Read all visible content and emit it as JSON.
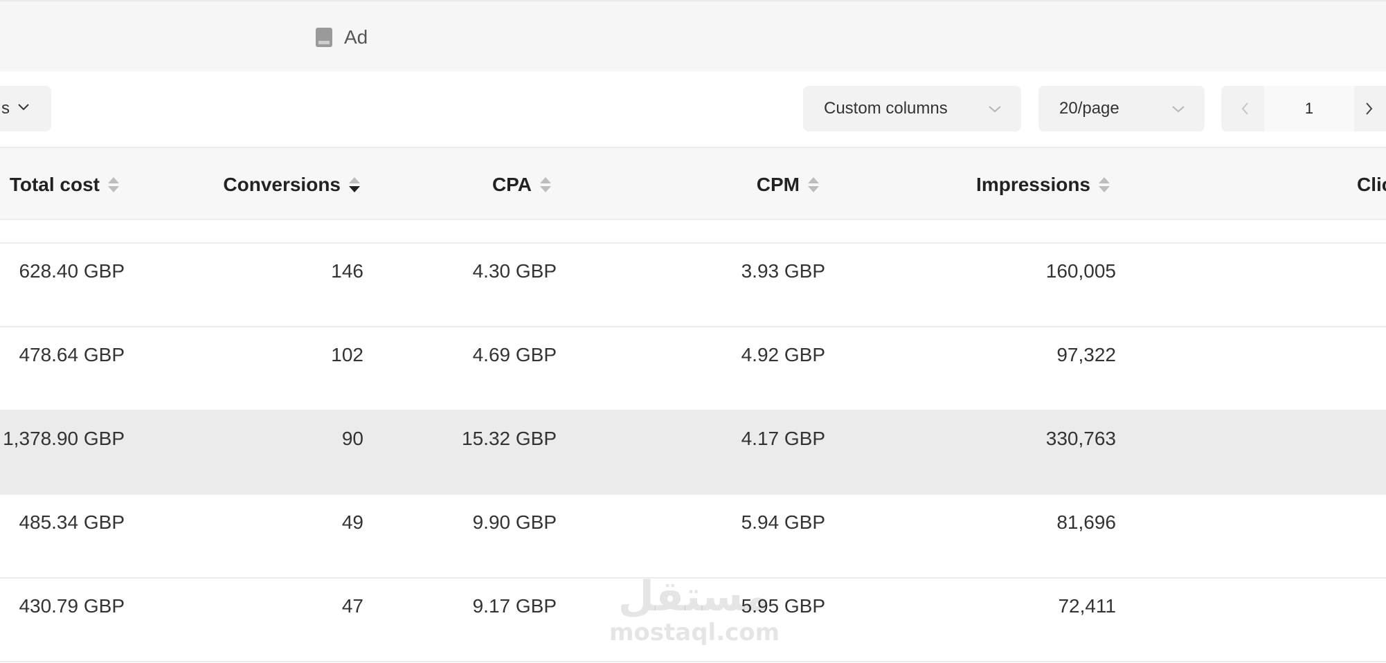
{
  "tab": {
    "icon": "document-icon",
    "label": "Ad"
  },
  "toolbar": {
    "left_partial_text": "s",
    "custom_columns_label": "Custom columns",
    "page_size_label": "20/page",
    "current_page": "1"
  },
  "table": {
    "headers": {
      "total_cost": "Total cost",
      "conversions": "Conversions",
      "cpa": "CPA",
      "cpm": "CPM",
      "impressions": "Impressions",
      "clicks_partial": "Clic"
    },
    "rows": [
      {
        "total_cost": "628.40 GBP",
        "conversions": "146",
        "cpa": "4.30 GBP",
        "cpm": "3.93 GBP",
        "impressions": "160,005"
      },
      {
        "total_cost": "478.64 GBP",
        "conversions": "102",
        "cpa": "4.69 GBP",
        "cpm": "4.92 GBP",
        "impressions": "97,322"
      },
      {
        "total_cost": "1,378.90 GBP",
        "conversions": "90",
        "cpa": "15.32 GBP",
        "cpm": "4.17 GBP",
        "impressions": "330,763"
      },
      {
        "total_cost": "485.34 GBP",
        "conversions": "49",
        "cpa": "9.90 GBP",
        "cpm": "5.94 GBP",
        "impressions": "81,696"
      },
      {
        "total_cost": "430.79 GBP",
        "conversions": "47",
        "cpa": "9.17 GBP",
        "cpm": "5.95 GBP",
        "impressions": "72,411"
      }
    ],
    "highlighted_row": 2,
    "sorted_column": "conversions",
    "sort_direction": "descending"
  },
  "watermark": {
    "arabic": "مستقل",
    "latin": "mostaql.com"
  },
  "colors": {
    "header_bg": "#f7f7f7",
    "topbar_bg": "#f6f6f6",
    "row_highlight": "#ebebeb",
    "control_bg": "#f2f2f2"
  }
}
